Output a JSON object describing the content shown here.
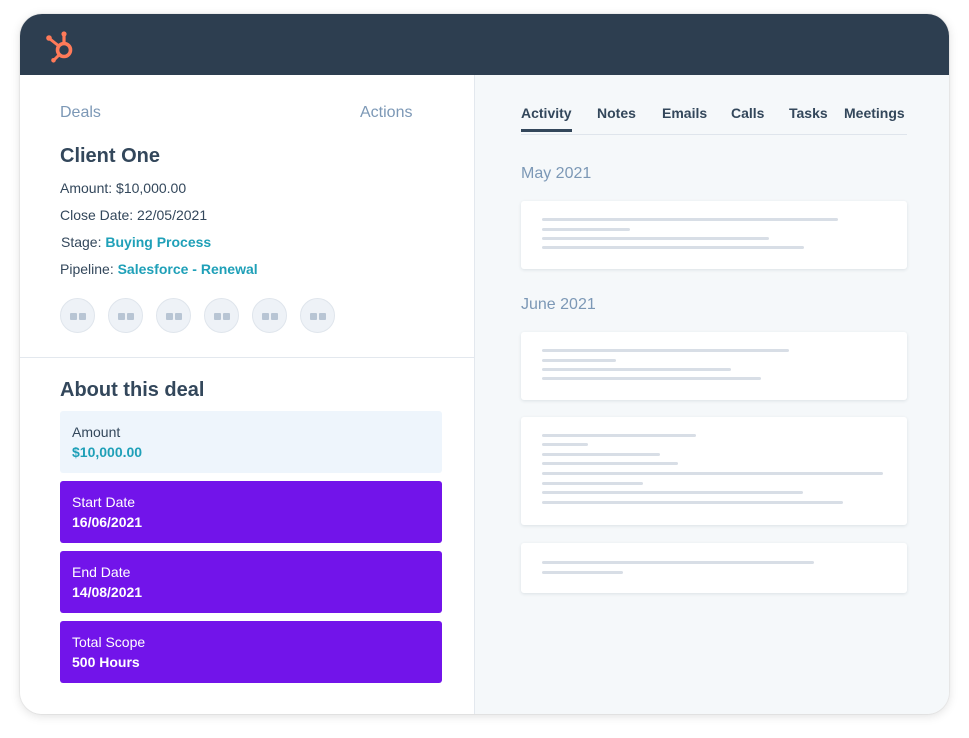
{
  "brand": {
    "logo_icon": "hubspot-sprocket-icon",
    "color": "#ff7a59",
    "header_color": "#2d3e50"
  },
  "deal_nav": {
    "deals_label": "Deals",
    "actions_label": "Actions"
  },
  "deal": {
    "name": "Client One",
    "amount_label": "Amount:",
    "amount_value": "$10,000.00",
    "close_label": "Close Date:",
    "close_value": "22/05/2021",
    "stage_label": "Stage:",
    "stage_value": "Buying Process",
    "pipeline_label": "Pipeline:",
    "pipeline_value": "Salesforce - Renewal"
  },
  "action_icons": [
    "placeholder-icon",
    "placeholder-icon",
    "placeholder-icon",
    "placeholder-icon",
    "placeholder-icon",
    "placeholder-icon"
  ],
  "about": {
    "title": "About this deal",
    "properties": [
      {
        "label": "Amount",
        "value": "$10,000.00",
        "style": "light"
      },
      {
        "label": "Start Date",
        "value": "16/06/2021",
        "style": "purple"
      },
      {
        "label": "End Date",
        "value": "14/08/2021",
        "style": "purple"
      },
      {
        "label": "Total Scope",
        "value": "500 Hours",
        "style": "purple"
      }
    ]
  },
  "tabs": [
    "Activity",
    "Notes",
    "Emails",
    "Calls",
    "Tasks",
    "Meetings"
  ],
  "active_tab": "Activity",
  "timeline": [
    {
      "month": "May 2021"
    },
    {
      "month": "June 2021"
    }
  ],
  "colors": {
    "accent_teal": "#1fa0b8",
    "purple": "#7214ea",
    "muted": "#7c98b6"
  }
}
